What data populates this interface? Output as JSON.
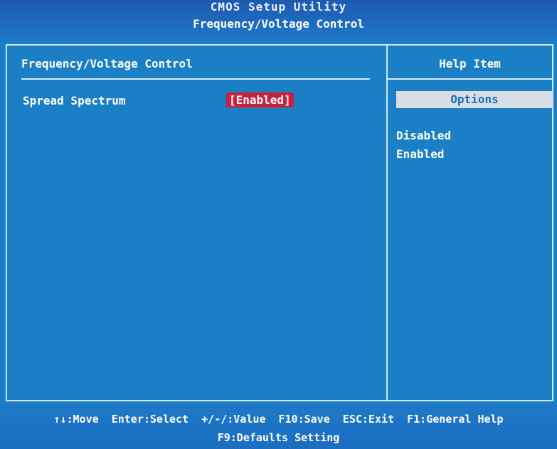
{
  "header": {
    "title": "CMOS Setup Utility",
    "subtitle": "Frequency/Voltage Control"
  },
  "left_panel": {
    "title": "Frequency/Voltage Control",
    "items": [
      {
        "label": "Spread Spectrum",
        "value": "[Enabled]"
      }
    ]
  },
  "help_panel": {
    "title": "Help Item",
    "options_header": "Options",
    "options": [
      "Disabled",
      "Enabled"
    ]
  },
  "footer": {
    "keys_line1": "↑↓:Move  Enter:Select  +/-/:Value  F10:Save  ESC:Exit  F1:General Help",
    "keys_line2": "F9:Defaults Setting"
  },
  "colors": {
    "background": "#1a7fc4",
    "highlight": "#c8203e",
    "options_bar": "#d8dee6"
  }
}
